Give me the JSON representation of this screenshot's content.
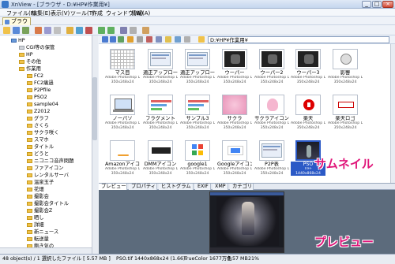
{
  "window": {
    "title": "XnView - [ブラウザ - D:¥HP¥作業用¥]",
    "buttons": [
      "_",
      "□",
      "×"
    ]
  },
  "menu": [
    "ファイル(F)",
    "編集(E)",
    "表示(V)",
    "ツール(T)",
    "作成",
    "ウィンドウ(W)",
    "情報(A)"
  ],
  "tab": {
    "label": "ブラウザ"
  },
  "path": "D:¥HP¥作業用¥",
  "tree": [
    {
      "label": "HP",
      "indent": 0,
      "type": "blue"
    },
    {
      "label": "CGI等の保管",
      "indent": 1,
      "type": "gray"
    },
    {
      "label": "HP",
      "indent": 1,
      "type": "folder"
    },
    {
      "label": "その他",
      "indent": 1,
      "type": "folder"
    },
    {
      "label": "作業用",
      "indent": 1,
      "type": "folder"
    },
    {
      "label": "FC2",
      "indent": 2,
      "type": "folder"
    },
    {
      "label": "FC2痛過",
      "indent": 2,
      "type": "folder"
    },
    {
      "label": "P2Pfile",
      "indent": 2,
      "type": "folder"
    },
    {
      "label": "PSO2",
      "indent": 2,
      "type": "folder"
    },
    {
      "label": "sample04",
      "indent": 2,
      "type": "folder"
    },
    {
      "label": "Z2012",
      "indent": 2,
      "type": "folder"
    },
    {
      "label": "グラフ",
      "indent": 2,
      "type": "folder"
    },
    {
      "label": "さくら",
      "indent": 2,
      "type": "folder"
    },
    {
      "label": "サクラ咲く",
      "indent": 2,
      "type": "folder"
    },
    {
      "label": "スマホ",
      "indent": 2,
      "type": "folder"
    },
    {
      "label": "タイトル",
      "indent": 2,
      "type": "folder"
    },
    {
      "label": "どうと",
      "indent": 2,
      "type": "folder"
    },
    {
      "label": "ニコニコ音声問題",
      "indent": 2,
      "type": "folder"
    },
    {
      "label": "ファアイコン",
      "indent": 2,
      "type": "folder"
    },
    {
      "label": "レンタルサーバ",
      "indent": 2,
      "type": "folder"
    },
    {
      "label": "温泉玉子",
      "indent": 2,
      "type": "folder"
    },
    {
      "label": "花畑",
      "indent": 2,
      "type": "folder"
    },
    {
      "label": "撮影会",
      "indent": 2,
      "type": "folder"
    },
    {
      "label": "撮影会タイトル",
      "indent": 2,
      "type": "folder"
    },
    {
      "label": "撮影会Z",
      "indent": 2,
      "type": "folder"
    },
    {
      "label": "晒し",
      "indent": 2,
      "type": "folder"
    },
    {
      "label": "詳細",
      "indent": 2,
      "type": "folder"
    },
    {
      "label": "新ニュース",
      "indent": 2,
      "type": "folder"
    },
    {
      "label": "転送量",
      "indent": 2,
      "type": "folder"
    },
    {
      "label": "飽き気の",
      "indent": 2,
      "type": "folder"
    }
  ],
  "thumbnails": [
    {
      "name": "マス目",
      "meta1": "Adobe Photoshop Do...",
      "meta2": "350x248x24",
      "art": "grid"
    },
    {
      "name": "適正アップロー...",
      "meta1": "Adobe Photoshop Do...",
      "meta2": "350x248x24",
      "art": "screen"
    },
    {
      "name": "適正アップロー...",
      "meta1": "Adobe Photoshop Do...",
      "meta2": "350x248x24",
      "art": "screen"
    },
    {
      "name": "ウーパー",
      "meta1": "Adobe Photoshop Do...",
      "meta2": "350x248x24",
      "art": "dark"
    },
    {
      "name": "ウーパー2",
      "meta1": "Adobe Photoshop Do...",
      "meta2": "350x248x24",
      "art": "dark"
    },
    {
      "name": "ウーパー3",
      "meta1": "Adobe Photoshop Do...",
      "meta2": "350x248x24",
      "art": "dark"
    },
    {
      "name": "影響",
      "meta1": "Adobe Photoshop Do...",
      "meta2": "350x248x24",
      "art": "icon"
    },
    {
      "name": "ノーパソ",
      "meta1": "Adobe Photoshop Do...",
      "meta2": "350x248x24",
      "art": "laptop"
    },
    {
      "name": "フラグメント",
      "meta1": "Adobe Photoshop Do...",
      "meta2": "350x248x24",
      "art": "bars"
    },
    {
      "name": "サンプル3",
      "meta1": "Adobe Photoshop Do...",
      "meta2": "350x248x24",
      "art": "bars"
    },
    {
      "name": "サクラ",
      "meta1": "Adobe Photoshop Do...",
      "meta2": "350x248x24",
      "art": "pink"
    },
    {
      "name": "サクラアイコン",
      "meta1": "Adobe Photoshop Do...",
      "meta2": "350x248x24",
      "art": "pink2"
    },
    {
      "name": "楽天",
      "meta1": "Adobe Photoshop Do...",
      "meta2": "350x248x24",
      "art": "rakuten"
    },
    {
      "name": "楽天ロゴ",
      "meta1": "Adobe Photoshop Do...",
      "meta2": "350x248x24",
      "art": "rakuten2"
    },
    {
      "name": "Amazonアイコン",
      "meta1": "Adobe Photoshop Do...",
      "meta2": "350x248x24",
      "art": "amazon"
    },
    {
      "name": "DMMアイコン",
      "meta1": "Adobe Photoshop Do...",
      "meta2": "350x248x24",
      "art": "dmm"
    },
    {
      "name": "google1",
      "meta1": "Adobe Photoshop Do...",
      "meta2": "350x248x24",
      "art": "google"
    },
    {
      "name": "Googleアイコン",
      "meta1": "Adobe Photoshop Do...",
      "meta2": "350x248x24",
      "art": "google2"
    },
    {
      "name": "P2P表",
      "meta1": "Adobe Photoshop Do...",
      "meta2": "350x248x24",
      "art": "screen"
    },
    {
      "name": "PSO",
      "meta1": "TIFF",
      "meta2": "1440x868x24",
      "art": "pso",
      "selected": true
    }
  ],
  "preview_tabs": [
    "プレビュー",
    "プロパティ",
    "ヒストグラム",
    "EXIF",
    "XMP",
    "カテゴリ"
  ],
  "overlay": {
    "thumbnail_label": "サムネイル",
    "preview_label": "プレビュー"
  },
  "status": {
    "objects": "48 object(s) / 1 選択したファイル [ 5.57 MB ]",
    "file": "PSO.tif",
    "dims": "1440x868x24 (1.66)",
    "color": "TrueColor 1677万色",
    "size": "5.57 MB",
    "zoom": "21%"
  },
  "colors": {
    "accent": "#2b59c6",
    "overlay_text": "#e0167a",
    "folder": "#f0c24a"
  }
}
